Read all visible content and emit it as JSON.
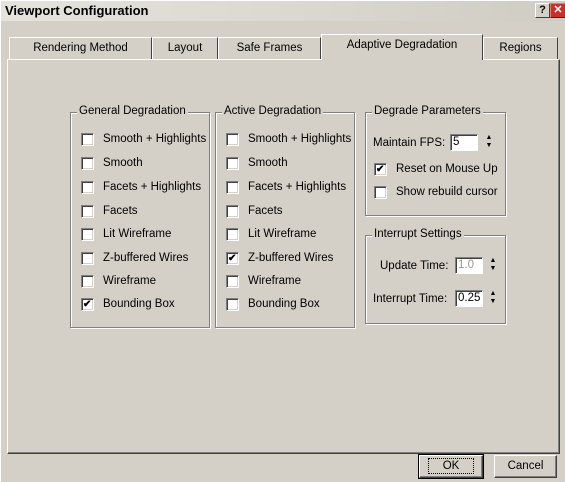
{
  "window": {
    "title": "Viewport Configuration",
    "help_glyph": "?",
    "close_glyph": "✕"
  },
  "tabs": [
    {
      "label": "Rendering Method",
      "active": false
    },
    {
      "label": "Layout",
      "active": false
    },
    {
      "label": "Safe Frames",
      "active": false
    },
    {
      "label": "Adaptive Degradation",
      "active": true
    },
    {
      "label": "Regions",
      "active": false
    }
  ],
  "general_degradation": {
    "title": "General Degradation",
    "items": [
      {
        "label": "Smooth + Highlights",
        "checked": false
      },
      {
        "label": "Smooth",
        "checked": false
      },
      {
        "label": "Facets + Highlights",
        "checked": false
      },
      {
        "label": "Facets",
        "checked": false
      },
      {
        "label": "Lit Wireframe",
        "checked": false
      },
      {
        "label": "Z-buffered Wires",
        "checked": false
      },
      {
        "label": "Wireframe",
        "checked": false
      },
      {
        "label": "Bounding Box",
        "checked": true
      }
    ]
  },
  "active_degradation": {
    "title": "Active Degradation",
    "items": [
      {
        "label": "Smooth + Highlights",
        "checked": false
      },
      {
        "label": "Smooth",
        "checked": false
      },
      {
        "label": "Facets + Highlights",
        "checked": false
      },
      {
        "label": "Facets",
        "checked": false
      },
      {
        "label": "Lit Wireframe",
        "checked": false
      },
      {
        "label": "Z-buffered Wires",
        "checked": true
      },
      {
        "label": "Wireframe",
        "checked": false
      },
      {
        "label": "Bounding Box",
        "checked": false
      }
    ]
  },
  "degrade_parameters": {
    "title": "Degrade Parameters",
    "maintain_fps_label": "Maintain FPS:",
    "maintain_fps_value": "5",
    "reset_on_mouse_up_label": "Reset on Mouse Up",
    "reset_on_mouse_up_checked": true,
    "show_rebuild_cursor_label": "Show rebuild cursor",
    "show_rebuild_cursor_checked": false
  },
  "interrupt_settings": {
    "title": "Interrupt Settings",
    "update_time_label": "Update Time:",
    "update_time_value": "1.0",
    "interrupt_time_label": "Interrupt Time:",
    "interrupt_time_value": "0.25"
  },
  "buttons": {
    "ok": "OK",
    "cancel": "Cancel"
  },
  "spinner_glyphs": {
    "up": "▲",
    "down": "▼"
  }
}
